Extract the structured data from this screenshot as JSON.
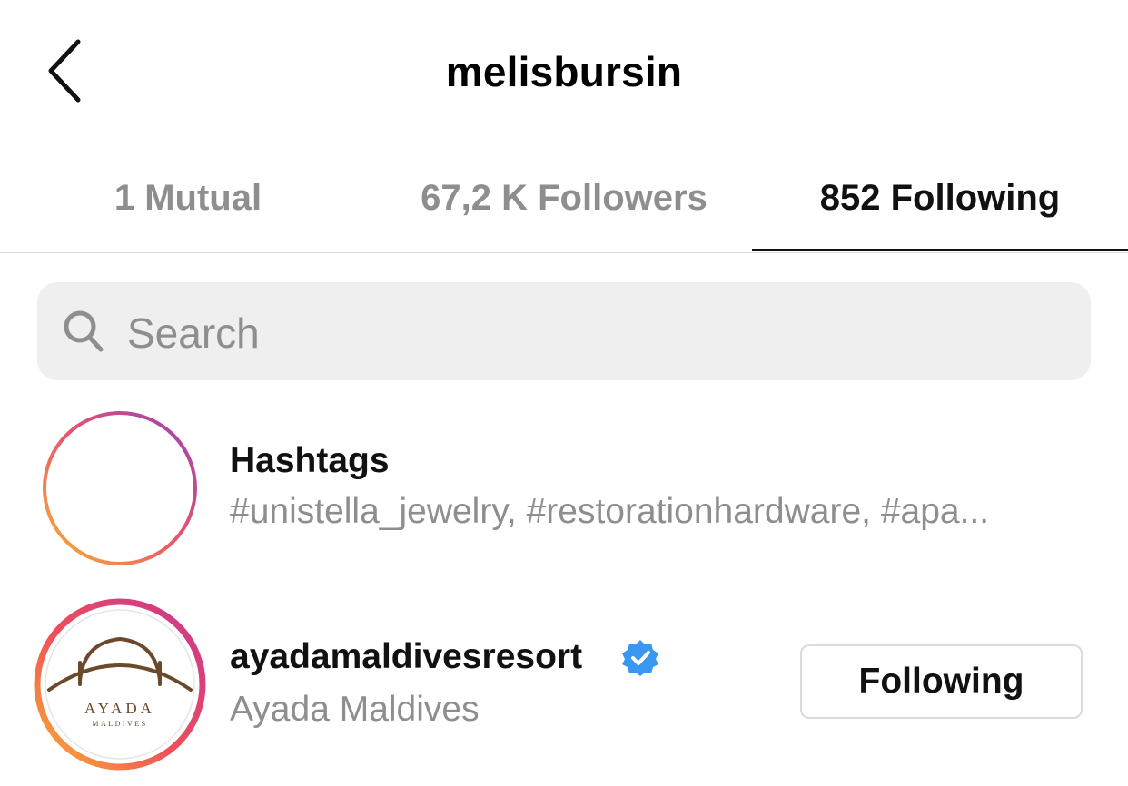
{
  "header": {
    "title": "melisbursin"
  },
  "tabs": [
    {
      "label": "1 Mutual"
    },
    {
      "label": "67,2 K Followers"
    },
    {
      "label": "852 Following"
    }
  ],
  "search": {
    "placeholder": "Search"
  },
  "list": {
    "hashtags": {
      "title": "Hashtags",
      "subtitle": "#unistella_jewelry, #restorationhardware, #apa..."
    },
    "account": {
      "username": "ayadamaldivesresort",
      "name": "Ayada Maldives",
      "verified": true,
      "button": "Following",
      "logo_text": "AYADA",
      "logo_sub": "MALDIVES"
    }
  },
  "colors": {
    "accent_blue": "#3897f0",
    "muted_text": "#8e8e8e",
    "search_bg": "#efefef"
  }
}
